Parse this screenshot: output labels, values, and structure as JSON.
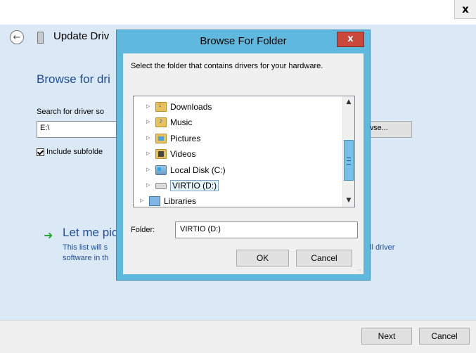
{
  "wizard": {
    "close_glyph": "x",
    "title": "Update Driv",
    "heading": "Browse for dri",
    "search_label": "Search for driver so",
    "path_value": "E:\\",
    "browse_label": "wse...",
    "include_subfolders_label": "Include subfolde",
    "include_subfolders_checked": true,
    "let_me_label": "Let me pic",
    "desc_line1": "This list will s",
    "desc_line2": "software in th",
    "desc_right": "ll driver",
    "next_label": "Next",
    "cancel_label": "Cancel",
    "colors": {
      "header_bg": "#dbe9f6",
      "link_blue": "#1e4c9c",
      "arrow_green": "#23a835"
    }
  },
  "dialog": {
    "title": "Browse For Folder",
    "close_glyph": "x",
    "instruction": "Select the folder that contains drivers for your hardware.",
    "tree_items": [
      {
        "label": "Downloads",
        "icon": "downloads-folder-icon",
        "selected": false
      },
      {
        "label": "Music",
        "icon": "music-folder-icon",
        "selected": false
      },
      {
        "label": "Pictures",
        "icon": "pictures-folder-icon",
        "selected": false
      },
      {
        "label": "Videos",
        "icon": "videos-folder-icon",
        "selected": false
      },
      {
        "label": "Local Disk (C:)",
        "icon": "local-disk-icon",
        "selected": false
      },
      {
        "label": "VIRTIO (D:)",
        "icon": "cd-drive-icon",
        "selected": true
      },
      {
        "label": "Libraries",
        "icon": "libraries-icon",
        "selected": false
      }
    ],
    "folder_label": "Folder:",
    "folder_value": "VIRTIO (D:)",
    "ok_label": "OK",
    "cancel_label": "Cancel",
    "colors": {
      "frame": "#5fb8de",
      "close_red": "#c9483b",
      "scroll_thumb": "#76c1e8"
    }
  }
}
